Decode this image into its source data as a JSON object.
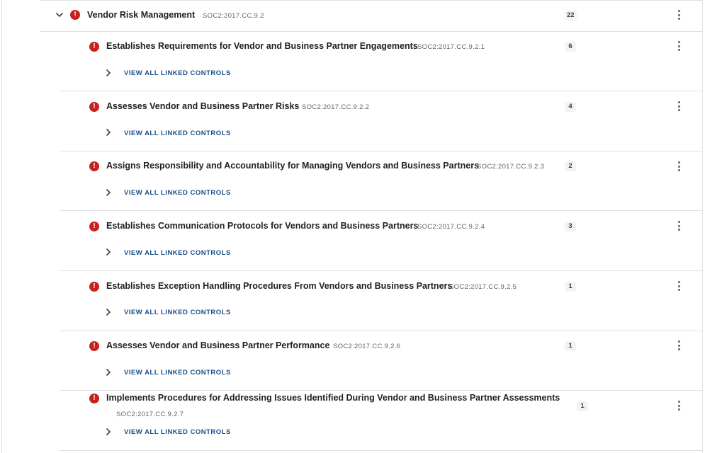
{
  "parent": {
    "title": "Vendor Risk Management",
    "code": "SOC2:2017.CC.9.2",
    "count": "22"
  },
  "view_all_label": "VIEW ALL LINKED CONTROLS",
  "children": [
    {
      "title": "Establishes Requirements for Vendor and Business Partner Engagements",
      "code": "SOC2:2017.CC.9.2.1",
      "count": "6"
    },
    {
      "title": "Assesses Vendor and Business Partner Risks",
      "code": "SOC2:2017.CC.9.2.2",
      "count": "4"
    },
    {
      "title": "Assigns Responsibility and Accountability for Managing Vendors and Business Partners",
      "code": "SOC2:2017.CC.9.2.3",
      "count": "2"
    },
    {
      "title": "Establishes Communication Protocols for Vendors and Business Partners",
      "code": "SOC2:2017.CC.9.2.4",
      "count": "3"
    },
    {
      "title": "Establishes Exception Handling Procedures From Vendors and Business Partners",
      "code": "SOC2:2017.CC.9.2.5",
      "count": "1"
    },
    {
      "title": "Assesses Vendor and Business Partner Performance",
      "code": "SOC2:2017.CC.9.2.6",
      "count": "1"
    },
    {
      "title": "Implements Procedures for Addressing Issues Identified During Vendor and Business Partner Assessments",
      "code": "SOC2:2017.CC.9.2.7",
      "count": "1"
    }
  ],
  "colors": {
    "error": "#c5221f",
    "link": "#1a4e8a",
    "divider": "#e0e0e0"
  },
  "icons": {
    "expand": "chevron-down-icon",
    "status": "error-icon",
    "collapse": "chevron-right-icon",
    "menu": "more-vert-icon"
  }
}
